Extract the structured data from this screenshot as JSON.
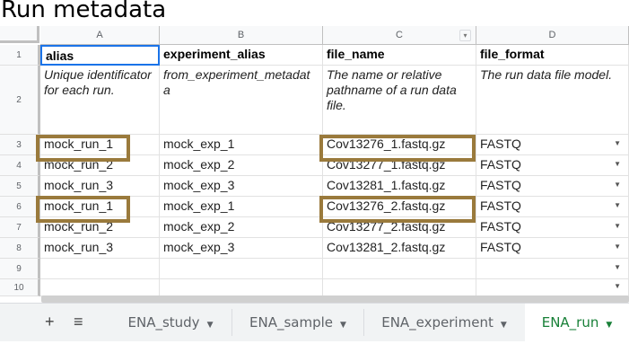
{
  "title": "Run metadata",
  "columns": [
    "A",
    "B",
    "C",
    "D"
  ],
  "row_numbers": [
    "1",
    "2",
    "3",
    "4",
    "5",
    "6",
    "7",
    "8",
    "9",
    "10"
  ],
  "header_row": [
    "alias",
    "experiment_alias",
    "file_name",
    "file_format"
  ],
  "description_row": [
    "Unique identificator for each run.",
    "from_experiment_metadat a",
    "The name or relative pathname of a run data file.",
    "The run data file model."
  ],
  "rows": [
    [
      "mock_run_1",
      "mock_exp_1",
      "Cov13276_1.fastq.gz",
      "FASTQ"
    ],
    [
      "mock_run_2",
      "mock_exp_2",
      "Cov13277_1.fastq.gz",
      "FASTQ"
    ],
    [
      "mock_run_3",
      "mock_exp_3",
      "Cov13281_1.fastq.gz",
      "FASTQ"
    ],
    [
      "mock_run_1",
      "mock_exp_1",
      "Cov13276_2.fastq.gz",
      "FASTQ"
    ],
    [
      "mock_run_2",
      "mock_exp_2",
      "Cov13277_2.fastq.gz",
      "FASTQ"
    ],
    [
      "mock_run_3",
      "mock_exp_3",
      "Cov13281_2.fastq.gz",
      "FASTQ"
    ]
  ],
  "tabs": {
    "add": "+",
    "list": "≡",
    "items": [
      "ENA_study",
      "ENA_sample",
      "ENA_experiment",
      "ENA_run"
    ],
    "active": "ENA_run",
    "arrow": "▼"
  },
  "colors": {
    "highlight": "#9a7a3c",
    "active_tab": "#188038"
  },
  "icons": {
    "dropdown": "chevron-down-icon",
    "filter": "filter-icon",
    "add": "plus-icon",
    "menu": "list-icon"
  }
}
